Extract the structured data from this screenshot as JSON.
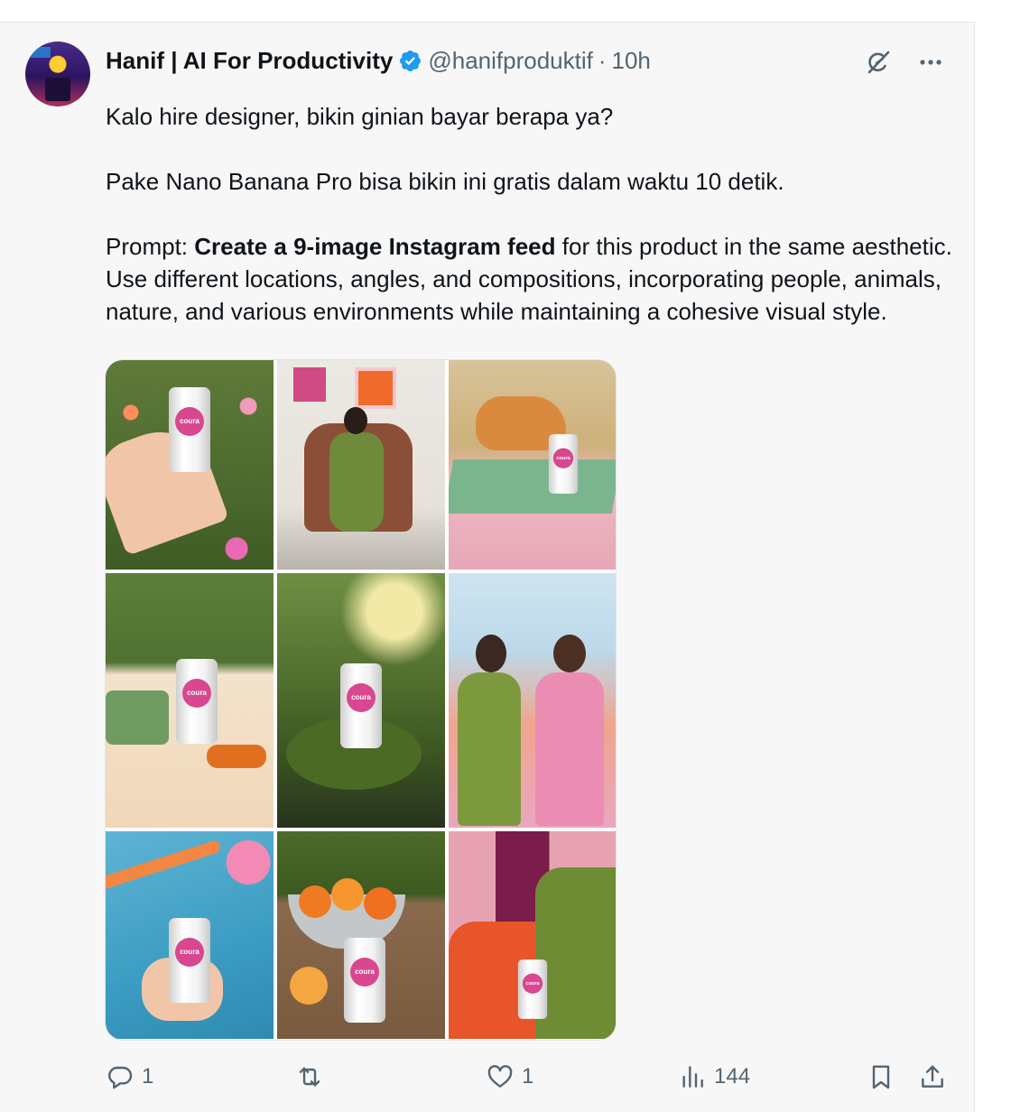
{
  "author": {
    "name": "Hanif | AI For Productivity",
    "handle": "@hanifproduktif",
    "separator": "·",
    "time": "10h"
  },
  "tweet": {
    "line1": "Kalo hire designer, bikin ginian bayar berapa ya?",
    "line2": "Pake Nano Banana Pro bisa bikin ini gratis dalam waktu 10 detik.",
    "prompt_label": "Prompt: ",
    "prompt_bold": "Create a 9-image Instagram feed",
    "prompt_rest": " for this product in the same aesthetic. Use different locations, angles, and compositions, incorporating people, animals, nature, and various environments while maintaining a cohesive visual style."
  },
  "media": {
    "can_brand": "coura",
    "tiles": [
      {
        "label": "hand holding can in flower field"
      },
      {
        "label": "woman in green suit on leather armchair"
      },
      {
        "label": "orange cat beside can on tiled table"
      },
      {
        "label": "picnic blanket with camera and sunglasses"
      },
      {
        "label": "can on mossy rock by stream"
      },
      {
        "label": "two women in green and pink suits toasting"
      },
      {
        "label": "hand holding can over swimming pool"
      },
      {
        "label": "can with oranges and grapefruit on wooden table"
      },
      {
        "label": "person in green suit on orange sofa"
      }
    ]
  },
  "stats": {
    "replies": "1",
    "reposts": "",
    "likes": "1",
    "views": "144"
  },
  "colors": {
    "text": "#0f1419",
    "muted": "#536471",
    "verified": "#1d9bf0",
    "background": "#f7f7f7"
  },
  "icons": [
    "verified-badge-icon",
    "grok-icon",
    "more-icon",
    "reply-icon",
    "repost-icon",
    "like-icon",
    "views-icon",
    "bookmark-icon",
    "share-icon"
  ]
}
